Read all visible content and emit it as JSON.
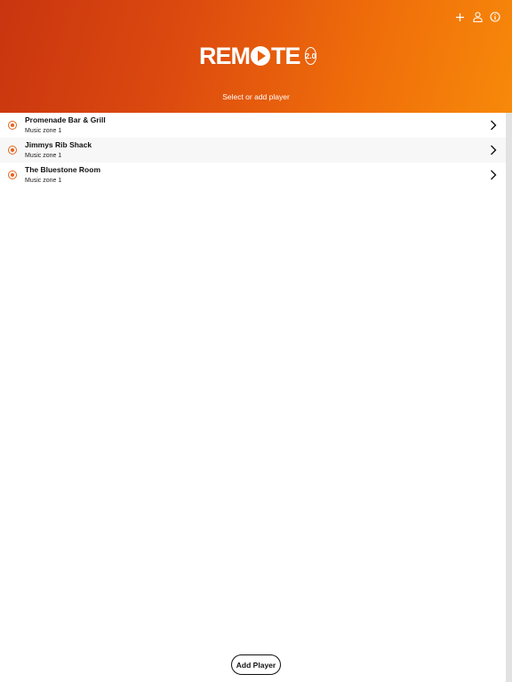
{
  "header": {
    "logo_text": "REMOTE",
    "logo_version": "2.0",
    "subtitle": "Select or add player",
    "icons": [
      "plus-icon",
      "user-icon",
      "info-icon"
    ]
  },
  "players": [
    {
      "name": "Promenade Bar & Grill",
      "zone": "Music zone 1"
    },
    {
      "name": "Jimmys Rib Shack",
      "zone": "Music zone 1"
    },
    {
      "name": "The Bluestone Room",
      "zone": "Music zone 1"
    }
  ],
  "footer": {
    "add_player_label": "Add Player"
  },
  "colors": {
    "accent": "#e6641c",
    "header_start": "#c9350f",
    "header_end": "#f7890a"
  }
}
